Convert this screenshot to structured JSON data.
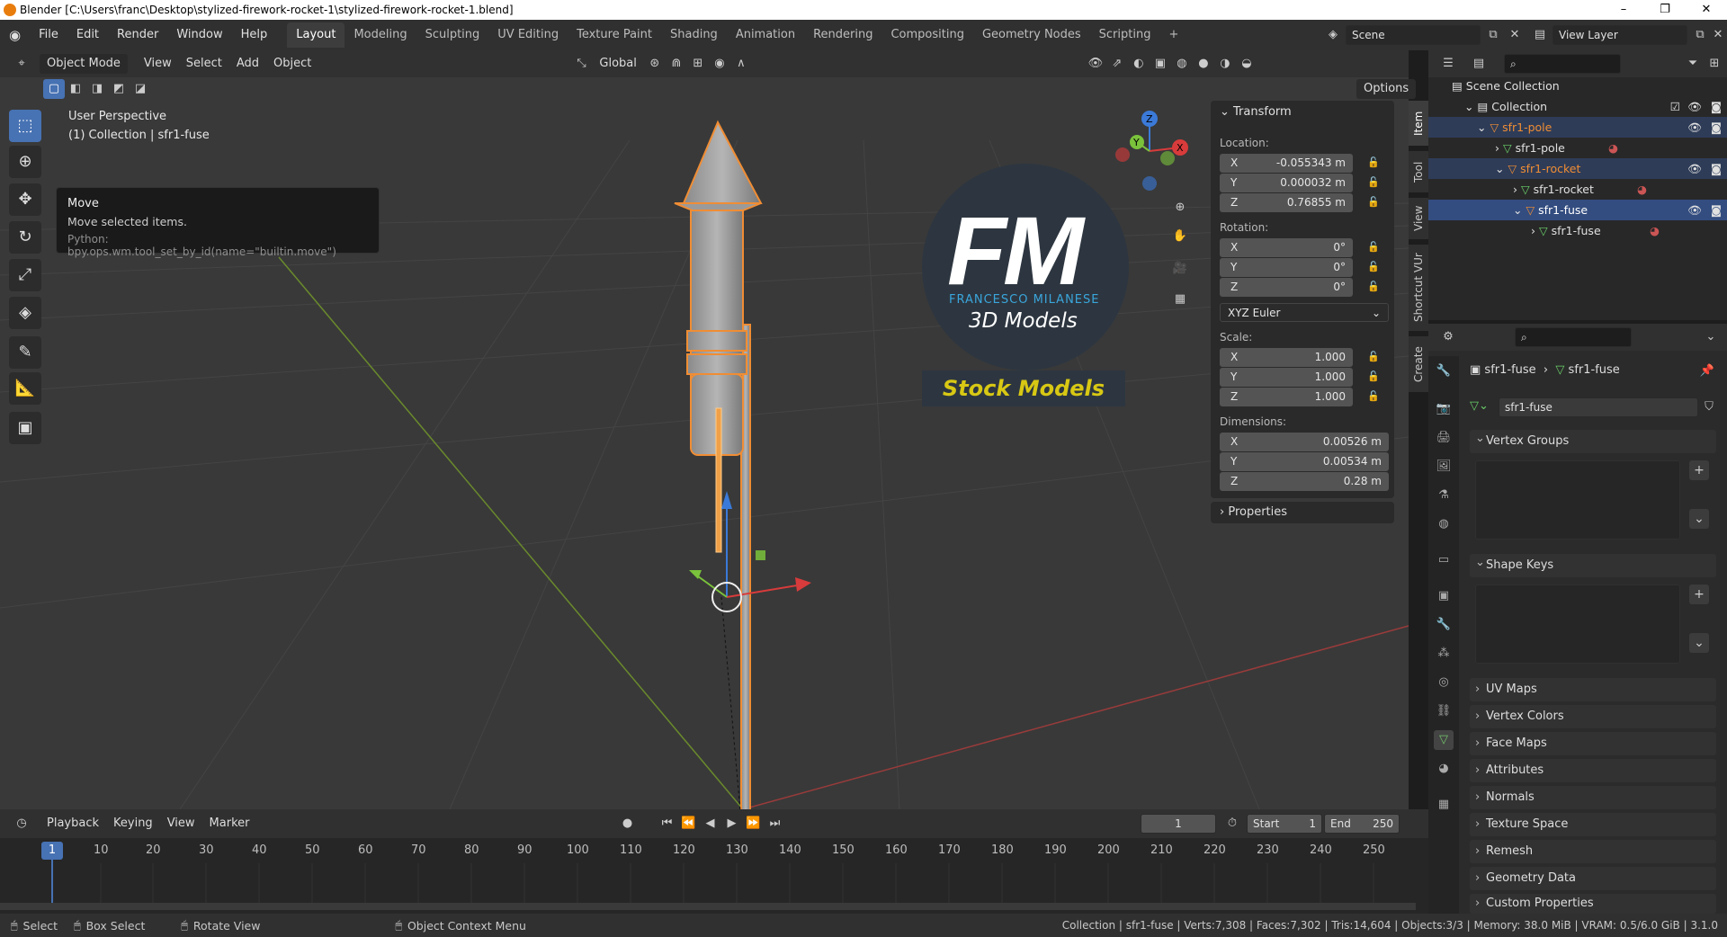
{
  "window": {
    "title": "Blender [C:\\Users\\franc\\Desktop\\stylized-firework-rocket-1\\stylized-firework-rocket-1.blend]",
    "minimize": "–",
    "maximize": "❐",
    "close": "✕"
  },
  "menu": [
    "File",
    "Edit",
    "Render",
    "Window",
    "Help"
  ],
  "workspaces": [
    "Layout",
    "Modeling",
    "Sculpting",
    "UV Editing",
    "Texture Paint",
    "Shading",
    "Animation",
    "Rendering",
    "Compositing",
    "Geometry Nodes",
    "Scripting",
    "+"
  ],
  "active_workspace": "Layout",
  "scene": {
    "name": "Scene",
    "view_layer": "View Layer"
  },
  "viewport_header": {
    "mode": "Object Mode",
    "menus": [
      "View",
      "Select",
      "Add",
      "Object"
    ],
    "transform_orientation": "Global",
    "options": "Options"
  },
  "viewport": {
    "perspective": "User Perspective",
    "collection_info": "(1) Collection | sfr1-fuse",
    "tooltip": {
      "title": "Move",
      "desc": "Move selected items.",
      "python": "Python: bpy.ops.wm.tool_set_by_id(name=\"builtin.move\")"
    },
    "watermark": {
      "initials": "FM",
      "name": "FRANCESCO MILANESE",
      "sub": "3D Models",
      "banner": "Stock Models"
    },
    "gizmo_axes": [
      "X",
      "Y",
      "Z"
    ]
  },
  "npanel": {
    "header": "Transform",
    "location_label": "Location:",
    "location": [
      {
        "axis": "X",
        "value": "-0.055343 m"
      },
      {
        "axis": "Y",
        "value": "0.000032 m"
      },
      {
        "axis": "Z",
        "value": "0.76855 m"
      }
    ],
    "rotation_label": "Rotation:",
    "rotation": [
      {
        "axis": "X",
        "value": "0°"
      },
      {
        "axis": "Y",
        "value": "0°"
      },
      {
        "axis": "Z",
        "value": "0°"
      }
    ],
    "rotation_mode": "XYZ Euler",
    "scale_label": "Scale:",
    "scale": [
      {
        "axis": "X",
        "value": "1.000"
      },
      {
        "axis": "Y",
        "value": "1.000"
      },
      {
        "axis": "Z",
        "value": "1.000"
      }
    ],
    "dimensions_label": "Dimensions:",
    "dimensions": [
      {
        "axis": "X",
        "value": "0.00526 m"
      },
      {
        "axis": "Y",
        "value": "0.00534 m"
      },
      {
        "axis": "Z",
        "value": "0.28 m"
      }
    ],
    "properties": "Properties"
  },
  "side_tabs": [
    "Item",
    "Tool",
    "View",
    "Shortcut VUr",
    "Create"
  ],
  "outliner": {
    "rows": [
      {
        "label": "Scene Collection"
      },
      {
        "label": "Collection"
      },
      {
        "label": "sfr1-pole"
      },
      {
        "label": "sfr1-pole"
      },
      {
        "label": "sfr1-rocket"
      },
      {
        "label": "sfr1-rocket"
      },
      {
        "label": "sfr1-fuse"
      },
      {
        "label": "sfr1-fuse"
      }
    ]
  },
  "properties": {
    "breadcrumb_obj": "sfr1-fuse",
    "breadcrumb_data": "sfr1-fuse",
    "datablock": "sfr1-fuse",
    "sections": [
      "Vertex Groups",
      "Shape Keys",
      "UV Maps",
      "Vertex Colors",
      "Face Maps",
      "Attributes",
      "Normals",
      "Texture Space",
      "Remesh",
      "Geometry Data",
      "Custom Properties"
    ]
  },
  "timeline": {
    "menus": [
      "Playback",
      "Keying",
      "View",
      "Marker"
    ],
    "current_frame": "1",
    "start_label": "Start",
    "start": "1",
    "end_label": "End",
    "end": "250",
    "frames": [
      "1",
      "10",
      "20",
      "30",
      "40",
      "50",
      "60",
      "70",
      "80",
      "90",
      "100",
      "110",
      "120",
      "130",
      "140",
      "150",
      "160",
      "170",
      "180",
      "190",
      "200",
      "210",
      "220",
      "230",
      "240",
      "250"
    ]
  },
  "statusbar": {
    "select": "Select",
    "box_select": "Box Select",
    "rotate_view": "Rotate View",
    "context_menu": "Object Context Menu",
    "stats": "Collection | sfr1-fuse | Verts:7,308 | Faces:7,302 | Tris:14,604 | Objects:3/3 | Memory: 38.0 MiB | VRAM: 0.5/6.0 GiB | 3.1.0"
  },
  "colors": {
    "accent": "#4772b3",
    "selection": "#f08d34",
    "bg_viewport": "#393939"
  }
}
